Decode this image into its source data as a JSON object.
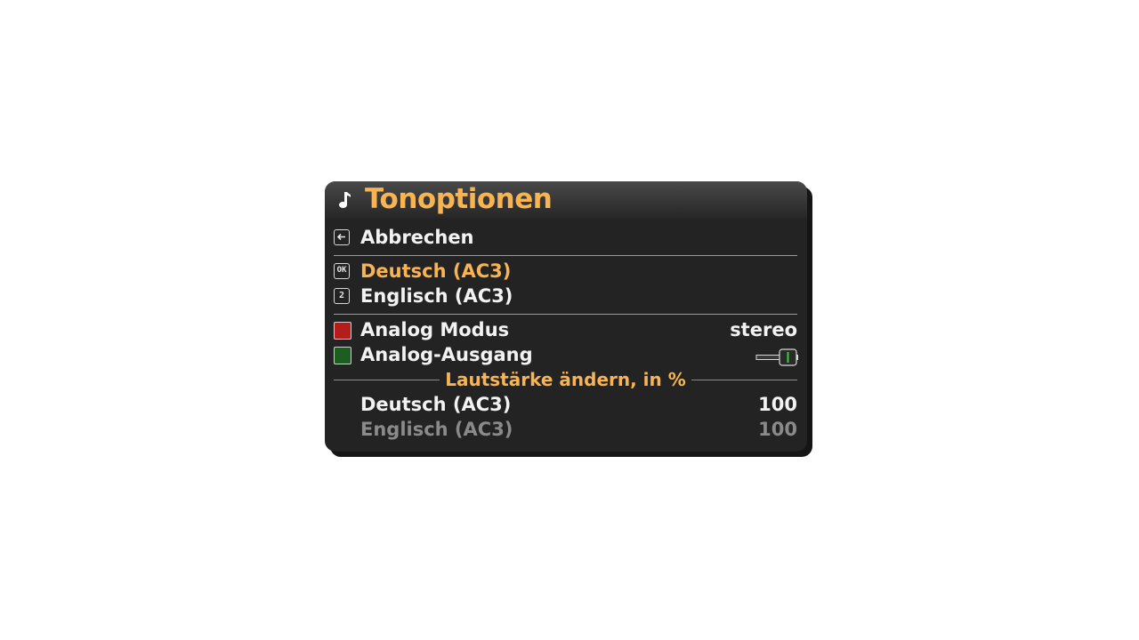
{
  "dialog": {
    "title": "Tonoptionen",
    "title_icon": "music-note-icon"
  },
  "actions": {
    "cancel_key": "back-arrow-icon",
    "cancel_label": "Abbrechen"
  },
  "tracks": [
    {
      "key": "OK",
      "label": "Deutsch (AC3)",
      "selected": true
    },
    {
      "key": "2",
      "label": "Englisch (AC3)",
      "selected": false
    }
  ],
  "settings": {
    "analog_mode": {
      "key_color": "#b71c1c",
      "label": "Analog Modus",
      "value": "stereo"
    },
    "analog_out": {
      "key_color": "#1b5e20",
      "label": "Analog-Ausgang",
      "toggle_on": true,
      "toggle_color": "#37d23b"
    }
  },
  "volume": {
    "section_title": "Lautstärke ändern, in %",
    "rows": [
      {
        "label": "Deutsch (AC3)",
        "value": "100",
        "dimmed": false
      },
      {
        "label": "Englisch (AC3)",
        "value": "100",
        "dimmed": true
      }
    ]
  },
  "colors": {
    "accent": "#f8b452",
    "panel_bg": "#232323",
    "text": "#f2f2f2",
    "dim_text": "#8a8a8a"
  }
}
